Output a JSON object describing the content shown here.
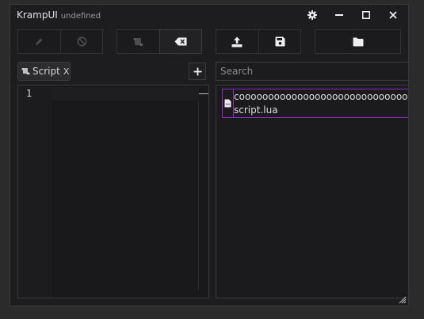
{
  "window": {
    "title": "KrampUI",
    "subtitle": "undefined"
  },
  "titlebar": {
    "buttons": [
      "gear-icon",
      "minimize-icon",
      "maximize-icon",
      "close-icon"
    ]
  },
  "toolbar": {
    "execute_icon": "pencil-icon",
    "kill_icon": "block-icon",
    "scripts_icon": "scroll-icon",
    "clear_icon": "backspace-icon",
    "import_icon": "upload-icon",
    "save_icon": "floppy-icon",
    "folder_icon": "folder-icon"
  },
  "tabs": [
    {
      "label": "Script",
      "close_label": "X",
      "icon": "scroll-icon"
    }
  ],
  "add_tab": {
    "label": "+"
  },
  "editor": {
    "line_numbers": [
      "1"
    ]
  },
  "search": {
    "placeholder": "Search"
  },
  "files": [
    {
      "name": "cooooooooooooooooooooooooooooooooooooooooo",
      "path": "script.lua",
      "icon": "file-icon",
      "selected": true
    }
  ],
  "colors": {
    "selection": "#8a28c8",
    "background": "#1d1d1f",
    "border": "#3a3a3c"
  }
}
